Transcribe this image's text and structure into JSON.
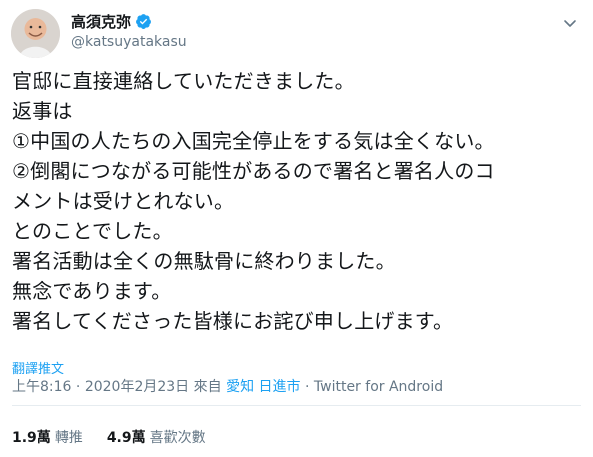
{
  "user": {
    "display_name": "高須克弥",
    "handle": "@katsuyatakasu",
    "verified": true
  },
  "tweet": {
    "text": "官邸に直接連絡していただきました。\n返事は\n①中国の人たちの入国完全停止をする気は全くない。\n②倒閣につながる可能性があるので署名と署名人のコ\nメントは受けとれない。\nとのことでした。\n署名活動は全くの無駄骨に終わりました。\n無念であります。\n署名してくださった皆様にお詫び申し上げます。",
    "translate_label": "翻譯推文",
    "time": "上午8:16",
    "date": "2020年2月23日",
    "from_label": "來自",
    "location": "愛知 日進市",
    "separator": "·",
    "client": "Twitter for Android"
  },
  "stats": {
    "retweets_count": "1.9萬",
    "retweets_label": "轉推",
    "likes_count": "4.9萬",
    "likes_label": "喜歡次數"
  },
  "colors": {
    "accent": "#1da1f2",
    "muted": "#657786",
    "text": "#14171a"
  },
  "icons": {
    "verified": "verified-badge-icon",
    "menu": "chevron-down-icon"
  }
}
